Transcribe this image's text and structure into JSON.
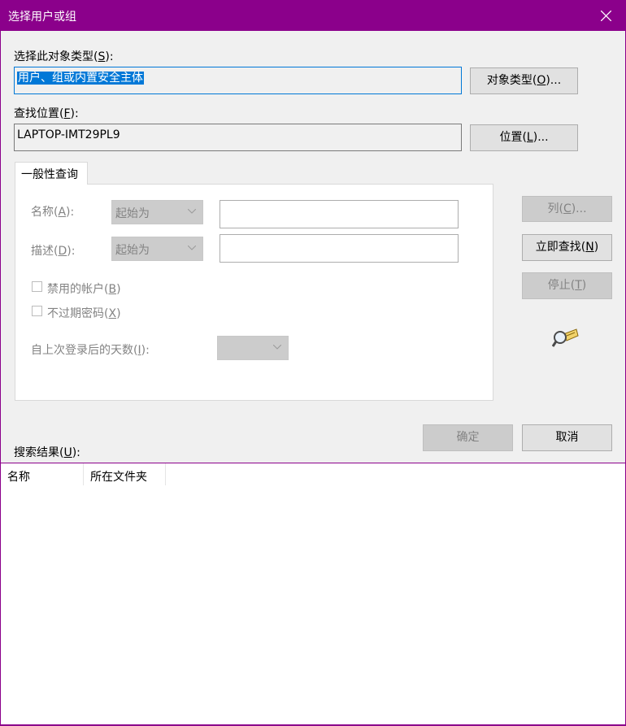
{
  "window": {
    "title": "选择用户或组"
  },
  "object_type": {
    "label": "选择此对象类型(",
    "label_key": "S",
    "label_end": "):",
    "value": "用户、组或内置安全主体",
    "button_label": "对象类型(",
    "button_key": "O",
    "button_end": ")..."
  },
  "location": {
    "label": "查找位置(",
    "label_key": "F",
    "label_end": "):",
    "value": "LAPTOP-IMT29PL9",
    "button_label": "位置(",
    "button_key": "L",
    "button_end": ")..."
  },
  "tab": {
    "label": "一般性查询"
  },
  "query": {
    "name_label": "名称(",
    "name_key": "A",
    "name_end": "):",
    "name_combo": "起始为",
    "desc_label": "描述(",
    "desc_key": "D",
    "desc_end": "):",
    "desc_combo": "起始为",
    "disabled_accounts_label": "禁用的帐户(",
    "disabled_accounts_key": "B",
    "disabled_accounts_end": ")",
    "no_expire_label": "不过期密码(",
    "no_expire_key": "X",
    "no_expire_end": ")",
    "days_label": "自上次登录后的天数(",
    "days_key": "I",
    "days_end": "):"
  },
  "side_buttons": {
    "columns_label": "列(",
    "columns_key": "C",
    "columns_end": ")...",
    "find_now_label": "立即查找(",
    "find_now_key": "N",
    "find_now_end": ")",
    "stop_label": "停止(",
    "stop_key": "T",
    "stop_end": ")"
  },
  "footer": {
    "ok_label": "确定",
    "cancel_label": "取消"
  },
  "results": {
    "label": "搜索结果(",
    "label_key": "U",
    "label_end": "):",
    "columns": [
      "名称",
      "所在文件夹"
    ]
  },
  "colors": {
    "titlebar": "#8b008b",
    "selection": "#0078d7"
  }
}
